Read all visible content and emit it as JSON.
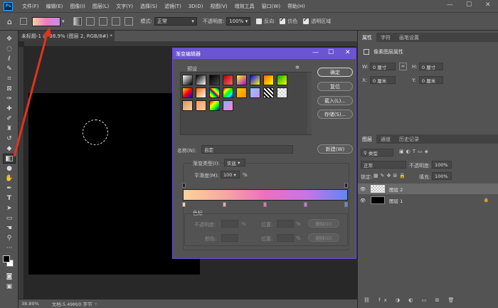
{
  "app": {
    "logo": "Ps"
  },
  "menu": [
    "文件(F)",
    "编辑(E)",
    "图像(I)",
    "图层(L)",
    "文字(Y)",
    "选择(S)",
    "滤镜(T)",
    "3D(D)",
    "视图(V)",
    "增效工具",
    "窗口(W)",
    "帮助(H)"
  ],
  "window_controls": {
    "min": "—",
    "max": "☐",
    "close": "✕"
  },
  "options": {
    "mode_label": "模式:",
    "mode_value": "正常",
    "opacity_label": "不透明度:",
    "opacity_value": "100%",
    "reverse_label": "反向",
    "dither_label": "仿色",
    "transparency_label": "透明区域"
  },
  "document": {
    "tab_title": "未标题-1 @ 38.9% (图层 2, RGB/8#) *",
    "tab_close": "✕",
    "status_zoom": "38.89%",
    "status_doc": "文档:5.49M/0 字节"
  },
  "properties": {
    "tabs": [
      "属性",
      "字符",
      "画笔设置"
    ],
    "heading": "像素图层属性",
    "w_label": "W:",
    "w_value": "0 厘寸",
    "h_label": "H:",
    "h_value": "0 厘寸",
    "x_label": "X:",
    "x_value": "0 厘米",
    "y_label": "Y:",
    "y_value": "0 厘米",
    "link_icon": "∞"
  },
  "layers": {
    "tabs": [
      "图层",
      "通道",
      "历史记录"
    ],
    "filter_value": "类型",
    "blend_value": "正常",
    "opacity_label": "不透明度:",
    "opacity_value": "100%",
    "lock_label": "锁定:",
    "fill_label": "填充:",
    "fill_value": "100%",
    "items": [
      {
        "name": "图层 2",
        "selected": true
      },
      {
        "name": "图层 1",
        "selected": false
      }
    ]
  },
  "gradient_editor": {
    "title": "渐变编辑器",
    "presets_label": "预设",
    "gear_icon": "✲",
    "buttons": {
      "ok": "确定",
      "reset": "复位",
      "load": "载入(L)...",
      "save": "存储(S)...",
      "new": "新建(W)"
    },
    "name_label": "名称(N):",
    "name_value": "自定",
    "type_label": "渐变类型(I):",
    "type_value": "实底",
    "smooth_label": "平滑度(M):",
    "smooth_value": "100",
    "smooth_unit": "%",
    "stops_label": "色标",
    "opacity_label": "不透明度:",
    "opacity_unit": "%",
    "location_label": "位置:",
    "location_unit": "%",
    "delete_label": "删除(D)",
    "color_label": "颜色:",
    "gradient_colors": [
      "#fbd39b",
      "#f7a8a0",
      "#ed6fbf",
      "#c875e5",
      "#5f86f4"
    ]
  },
  "arrow_color": "#e0341c"
}
